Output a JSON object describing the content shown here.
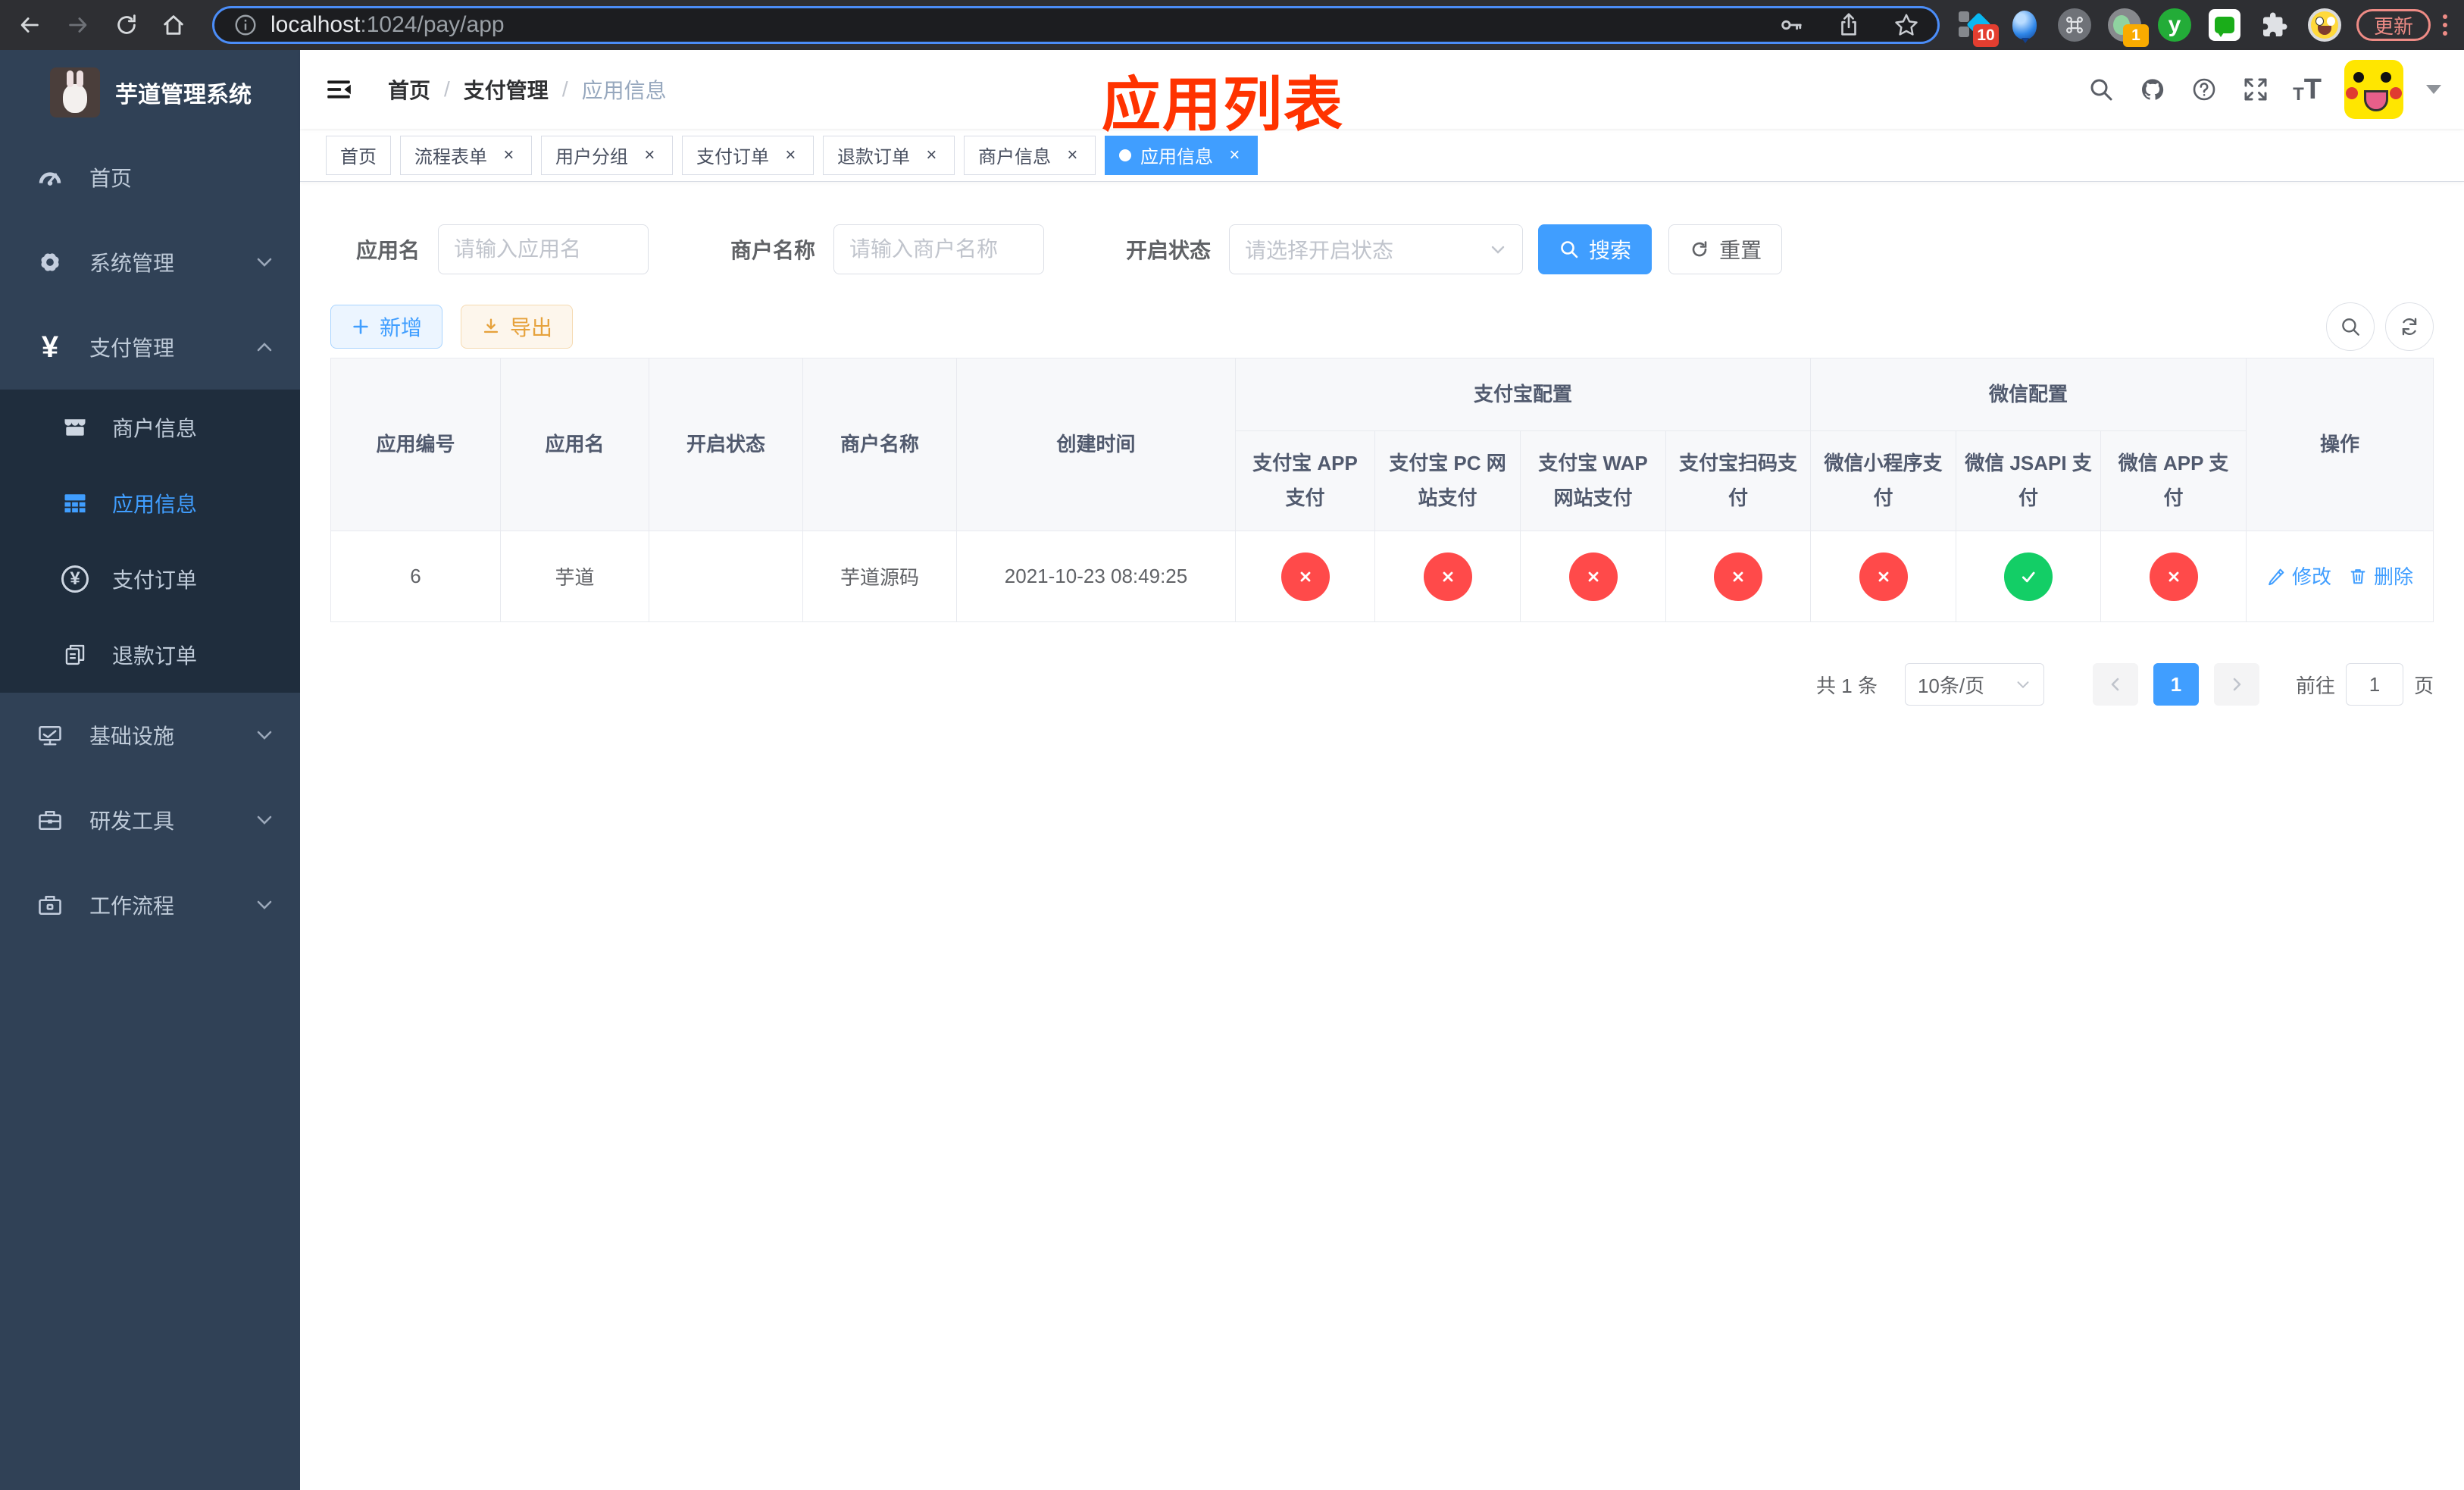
{
  "browser": {
    "url": {
      "host": "localhost",
      "rest": ":1024/pay/app"
    },
    "update_label": "更新",
    "ext": {
      "diamond_badge": "10",
      "record_badge": "1",
      "youdao_letter": "y"
    }
  },
  "sidebar": {
    "logo_title": "芋道管理系统",
    "yen_glyph": "¥",
    "menu": [
      {
        "label": "首页"
      },
      {
        "label": "系统管理"
      },
      {
        "label": "支付管理"
      }
    ],
    "submenu": [
      {
        "label": "商户信息"
      },
      {
        "label": "应用信息",
        "active": true
      },
      {
        "label": "支付订单"
      },
      {
        "label": "退款订单"
      }
    ],
    "menu_bottom": [
      {
        "label": "基础设施"
      },
      {
        "label": "研发工具"
      },
      {
        "label": "工作流程"
      }
    ]
  },
  "header": {
    "breadcrumb": [
      "首页",
      "支付管理",
      "应用信息"
    ],
    "breadcrumb_sep": "/",
    "annotation_title": "应用列表",
    "font_icon_letter": "T"
  },
  "tabs": [
    {
      "label": "首页",
      "closable": false,
      "active": false
    },
    {
      "label": "流程表单",
      "closable": true,
      "active": false
    },
    {
      "label": "用户分组",
      "closable": true,
      "active": false
    },
    {
      "label": "支付订单",
      "closable": true,
      "active": false
    },
    {
      "label": "退款订单",
      "closable": true,
      "active": false
    },
    {
      "label": "商户信息",
      "closable": true,
      "active": false
    },
    {
      "label": "应用信息",
      "closable": true,
      "active": true
    }
  ],
  "filters": {
    "app_name_label": "应用名",
    "app_name_placeholder": "请输入应用名",
    "merchant_label": "商户名称",
    "merchant_placeholder": "请输入商户名称",
    "status_label": "开启状态",
    "status_placeholder": "请选择开启状态",
    "search_label": "搜索",
    "reset_label": "重置"
  },
  "actions": {
    "add_label": "新增",
    "export_label": "导出"
  },
  "table": {
    "columns": [
      "应用编号",
      "应用名",
      "开启状态",
      "商户名称",
      "创建时间"
    ],
    "groups": {
      "alipay": "支付宝配置",
      "wechat": "微信配置"
    },
    "alipay_columns": [
      "支付宝 APP 支付",
      "支付宝 PC 网站支付",
      "支付宝 WAP 网站支付",
      "支付宝扫码支付"
    ],
    "wechat_columns": [
      "微信小程序支付",
      "微信 JSAPI 支付",
      "微信 APP 支付"
    ],
    "ops_column": "操作",
    "row": {
      "id": "6",
      "name": "芋道",
      "enabled": true,
      "merchant": "芋道源码",
      "created_at": "2021-10-23 08:49:25",
      "channels": [
        "disabled",
        "disabled",
        "disabled",
        "disabled",
        "disabled",
        "enabled",
        "disabled"
      ],
      "edit_label": "修改",
      "delete_label": "删除"
    }
  },
  "pagination": {
    "total": "共 1 条",
    "page_size": "10条/页",
    "current_page": "1",
    "goto_label": "前往",
    "goto_value": "1",
    "page_suffix": "页"
  },
  "colors": {
    "primary": "#409eff",
    "sidebar_bg": "#304156",
    "submenu_bg": "#1f2d3d",
    "danger_circle": "#ff4a4a",
    "success_circle": "#13ce66",
    "annotation_red": "#ff3300"
  }
}
